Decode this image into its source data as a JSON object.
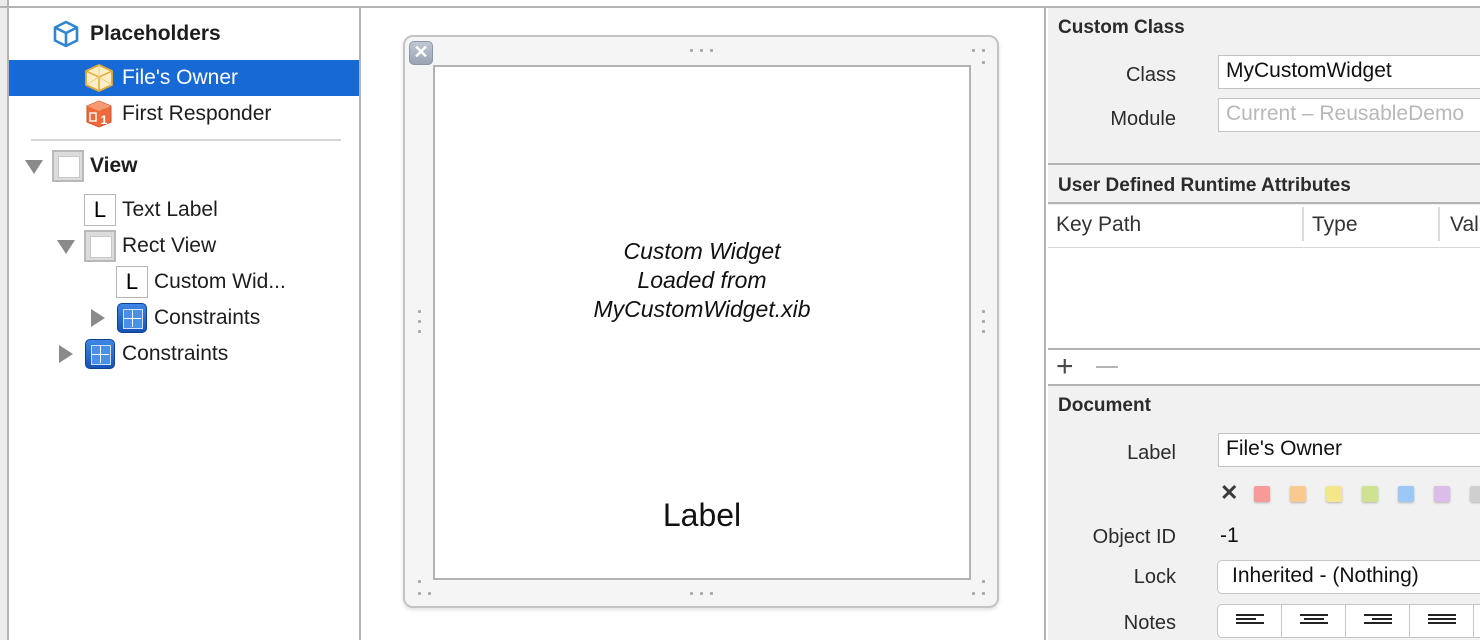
{
  "outline": {
    "placeholders_label": "Placeholders",
    "files_owner_label": "File's Owner",
    "first_responder_label": "First Responder",
    "view_label": "View",
    "text_label": "Text Label",
    "rect_view_label": "Rect View",
    "custom_widget_label": "Custom Wid...",
    "rect_constraints_label": "Constraints",
    "view_constraints_label": "Constraints",
    "first_responder_badge": "1",
    "label_icon_glyph": "L",
    "selected_item": "File's Owner"
  },
  "canvas": {
    "close_glyph": "✕",
    "widget_lines": [
      "Custom Widget",
      "Loaded from",
      "MyCustomWidget.xib"
    ],
    "label_text": "Label"
  },
  "inspector": {
    "custom_class": {
      "title": "Custom Class",
      "class_label": "Class",
      "class_value": "MyCustomWidget",
      "module_label": "Module",
      "module_placeholder": "Current – ReusableDemo"
    },
    "runtime_attributes": {
      "title": "User Defined Runtime Attributes",
      "columns": [
        "Key Path",
        "Type",
        "Val"
      ],
      "rows": [],
      "add_glyph": "+",
      "remove_glyph": "—"
    },
    "document": {
      "title": "Document",
      "label_label": "Label",
      "label_value": "File's Owner",
      "clear_glyph": "✕",
      "swatch_colors": [
        "#f99a9a",
        "#f9c98e",
        "#f5e68c",
        "#cfe28f",
        "#9cc8f7",
        "#dcbde9",
        "#cfcfcf"
      ],
      "object_id_label": "Object ID",
      "object_id_value": "-1",
      "lock_label": "Lock",
      "lock_value": "Inherited - (Nothing)",
      "notes_label": "Notes",
      "notes_alignments": [
        "align-left",
        "align-center",
        "align-right",
        "align-justify"
      ]
    }
  },
  "colors": {
    "selection": "#1769d6",
    "placeholder_icon": "#2f86d3",
    "files_owner_icon": "#f5c65a",
    "first_responder_icon": "#ee6a3c",
    "constraints_icon": "#1f63c8"
  }
}
